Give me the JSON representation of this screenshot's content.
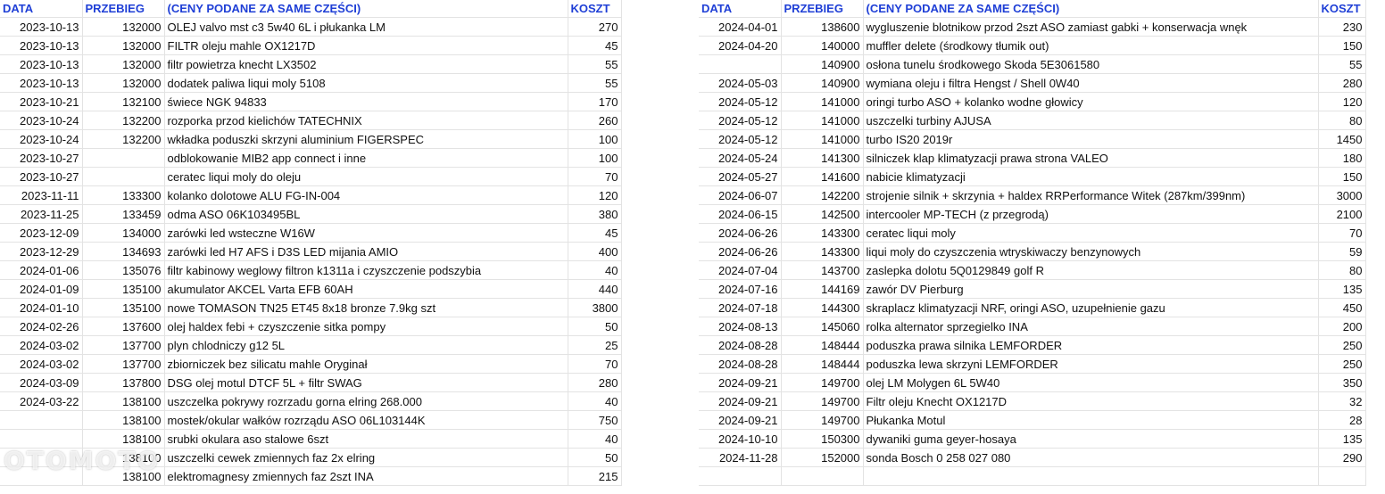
{
  "columns": {
    "date": "DATA",
    "mileage": "PRZEBIEG",
    "description": "(CENY PODANE ZA SAME CZĘŚCI)",
    "cost": "KOSZT"
  },
  "left_rows": [
    {
      "date": "2023-10-13",
      "mileage": "132000",
      "desc": "OLEJ valvo mst c3 5w40 6L i płukanka LM",
      "cost": "270"
    },
    {
      "date": "2023-10-13",
      "mileage": "132000",
      "desc": "FILTR oleju mahle OX1217D",
      "cost": "45"
    },
    {
      "date": "2023-10-13",
      "mileage": "132000",
      "desc": "filtr powietrza knecht LX3502",
      "cost": "55"
    },
    {
      "date": "2023-10-13",
      "mileage": "132000",
      "desc": "dodatek paliwa liqui moly 5108",
      "cost": "55"
    },
    {
      "date": "2023-10-21",
      "mileage": "132100",
      "desc": "świece NGK 94833",
      "cost": "170"
    },
    {
      "date": "2023-10-24",
      "mileage": "132200",
      "desc": "rozporka przod kielichów TATECHNIX",
      "cost": "260"
    },
    {
      "date": "2023-10-24",
      "mileage": "132200",
      "desc": "wkładka poduszki skrzyni aluminium FIGERSPEC",
      "cost": "100"
    },
    {
      "date": "2023-10-27",
      "mileage": "",
      "desc": "odblokowanie MIB2 app connect i inne",
      "cost": "100"
    },
    {
      "date": "2023-10-27",
      "mileage": "",
      "desc": "ceratec liqui moly do oleju",
      "cost": "70"
    },
    {
      "date": "2023-11-11",
      "mileage": "133300",
      "desc": "kolanko dolotowe ALU FG-IN-004",
      "cost": "120"
    },
    {
      "date": "2023-11-25",
      "mileage": "133459",
      "desc": "odma ASO 06K103495BL",
      "cost": "380"
    },
    {
      "date": "2023-12-09",
      "mileage": "134000",
      "desc": "zarówki led wsteczne W16W",
      "cost": "45"
    },
    {
      "date": "2023-12-29",
      "mileage": "134693",
      "desc": "zarówki led H7 AFS i D3S LED mijania AMIO",
      "cost": "400"
    },
    {
      "date": "2024-01-06",
      "mileage": "135076",
      "desc": "filtr kabinowy weglowy filtron k1311a i czyszczenie podszybia",
      "cost": "40"
    },
    {
      "date": "2024-01-09",
      "mileage": "135100",
      "desc": "akumulator AKCEL Varta EFB 60AH",
      "cost": "440"
    },
    {
      "date": "2024-01-10",
      "mileage": "135100",
      "desc": "nowe TOMASON TN25 ET45 8x18 bronze 7.9kg szt",
      "cost": "3800"
    },
    {
      "date": "2024-02-26",
      "mileage": "137600",
      "desc": "olej haldex febi + czyszczenie sitka pompy",
      "cost": "50"
    },
    {
      "date": "2024-03-02",
      "mileage": "137700",
      "desc": "plyn chlodniczy g12 5L",
      "cost": "25"
    },
    {
      "date": "2024-03-02",
      "mileage": "137700",
      "desc": "zbiorniczek bez silicatu mahle Oryginał",
      "cost": "70"
    },
    {
      "date": "2024-03-09",
      "mileage": "137800",
      "desc": "DSG olej motul DTCF 5L + filtr SWAG",
      "cost": "280"
    },
    {
      "date": "2024-03-22",
      "mileage": "138100",
      "desc": "uszczelka pokrywy rozrzadu gorna elring 268.000",
      "cost": "40"
    },
    {
      "date": "",
      "mileage": "138100",
      "desc": "mostek/okular wałków rozrządu ASO 06L103144K",
      "cost": "750"
    },
    {
      "date": "",
      "mileage": "138100",
      "desc": "srubki okulara aso stalowe 6szt",
      "cost": "40"
    },
    {
      "date": "",
      "mileage": "138100",
      "desc": "uszczelki cewek zmiennych faz 2x elring",
      "cost": "50"
    },
    {
      "date": "",
      "mileage": "138100",
      "desc": "elektromagnesy zmiennych faz 2szt INA",
      "cost": "215"
    }
  ],
  "right_rows": [
    {
      "date": "2024-04-01",
      "mileage": "138600",
      "desc": "wygluszenie blotnikow przod 2szt ASO zamiast gabki + konserwacja wnęk",
      "cost": "230"
    },
    {
      "date": "2024-04-20",
      "mileage": "140000",
      "desc": "muffler delete (środkowy tłumik out)",
      "cost": "150"
    },
    {
      "date": "",
      "mileage": "140900",
      "desc": "osłona tunelu środkowego Skoda 5E3061580",
      "cost": "55"
    },
    {
      "date": "2024-05-03",
      "mileage": "140900",
      "desc": "wymiana oleju i filtra Hengst / Shell 0W40",
      "cost": "280"
    },
    {
      "date": "2024-05-12",
      "mileage": "141000",
      "desc": "oringi turbo ASO + kolanko wodne głowicy",
      "cost": "120"
    },
    {
      "date": "2024-05-12",
      "mileage": "141000",
      "desc": "uszczelki turbiny AJUSA",
      "cost": "80"
    },
    {
      "date": "2024-05-12",
      "mileage": "141000",
      "desc": "turbo IS20 2019r",
      "cost": "1450"
    },
    {
      "date": "2024-05-24",
      "mileage": "141300",
      "desc": "silniczek klap klimatyzacji prawa strona VALEO",
      "cost": "180"
    },
    {
      "date": "2024-05-27",
      "mileage": "141600",
      "desc": "nabicie klimatyzacji",
      "cost": "150"
    },
    {
      "date": "2024-06-07",
      "mileage": "142200",
      "desc": "strojenie silnik + skrzynia + haldex RRPerformance Witek (287km/399nm)",
      "cost": "3000"
    },
    {
      "date": "2024-06-15",
      "mileage": "142500",
      "desc": "intercooler MP-TECH (z przegrodą)",
      "cost": "2100"
    },
    {
      "date": "2024-06-26",
      "mileage": "143300",
      "desc": "ceratec liqui moly",
      "cost": "70"
    },
    {
      "date": "2024-06-26",
      "mileage": "143300",
      "desc": "liqui moly do czyszczenia wtryskiwaczy benzynowych",
      "cost": "59"
    },
    {
      "date": "2024-07-04",
      "mileage": "143700",
      "desc": "zaslepka dolotu 5Q0129849 golf R",
      "cost": "80"
    },
    {
      "date": "2024-07-16",
      "mileage": "144169",
      "desc": "zawór DV Pierburg",
      "cost": "135"
    },
    {
      "date": "2024-07-18",
      "mileage": "144300",
      "desc": "skraplacz klimatyzacji NRF, oringi ASO, uzupełnienie gazu",
      "cost": "450"
    },
    {
      "date": "2024-08-13",
      "mileage": "145060",
      "desc": "rolka alternator sprzegielko INA",
      "cost": "200"
    },
    {
      "date": "2024-08-28",
      "mileage": "148444",
      "desc": "poduszka prawa silnika LEMFORDER",
      "cost": "250"
    },
    {
      "date": "2024-08-28",
      "mileage": "148444",
      "desc": "poduszka lewa skrzyni LEMFORDER",
      "cost": "250"
    },
    {
      "date": "2024-09-21",
      "mileage": "149700",
      "desc": "olej LM Molygen 6L 5W40",
      "cost": "350"
    },
    {
      "date": "2024-09-21",
      "mileage": "149700",
      "desc": "Filtr oleju Knecht OX1217D",
      "cost": "32"
    },
    {
      "date": "2024-09-21",
      "mileage": "149700",
      "desc": "Płukanka Motul",
      "cost": "28"
    },
    {
      "date": "2024-10-10",
      "mileage": "150300",
      "desc": "dywaniki guma geyer-hosaya",
      "cost": "135"
    },
    {
      "date": "2024-11-28",
      "mileage": "152000",
      "desc": "sonda Bosch 0 258 027 080",
      "cost": "290"
    },
    {
      "date": "",
      "mileage": "",
      "desc": "",
      "cost": ""
    }
  ],
  "watermark": "OTOMOTO"
}
